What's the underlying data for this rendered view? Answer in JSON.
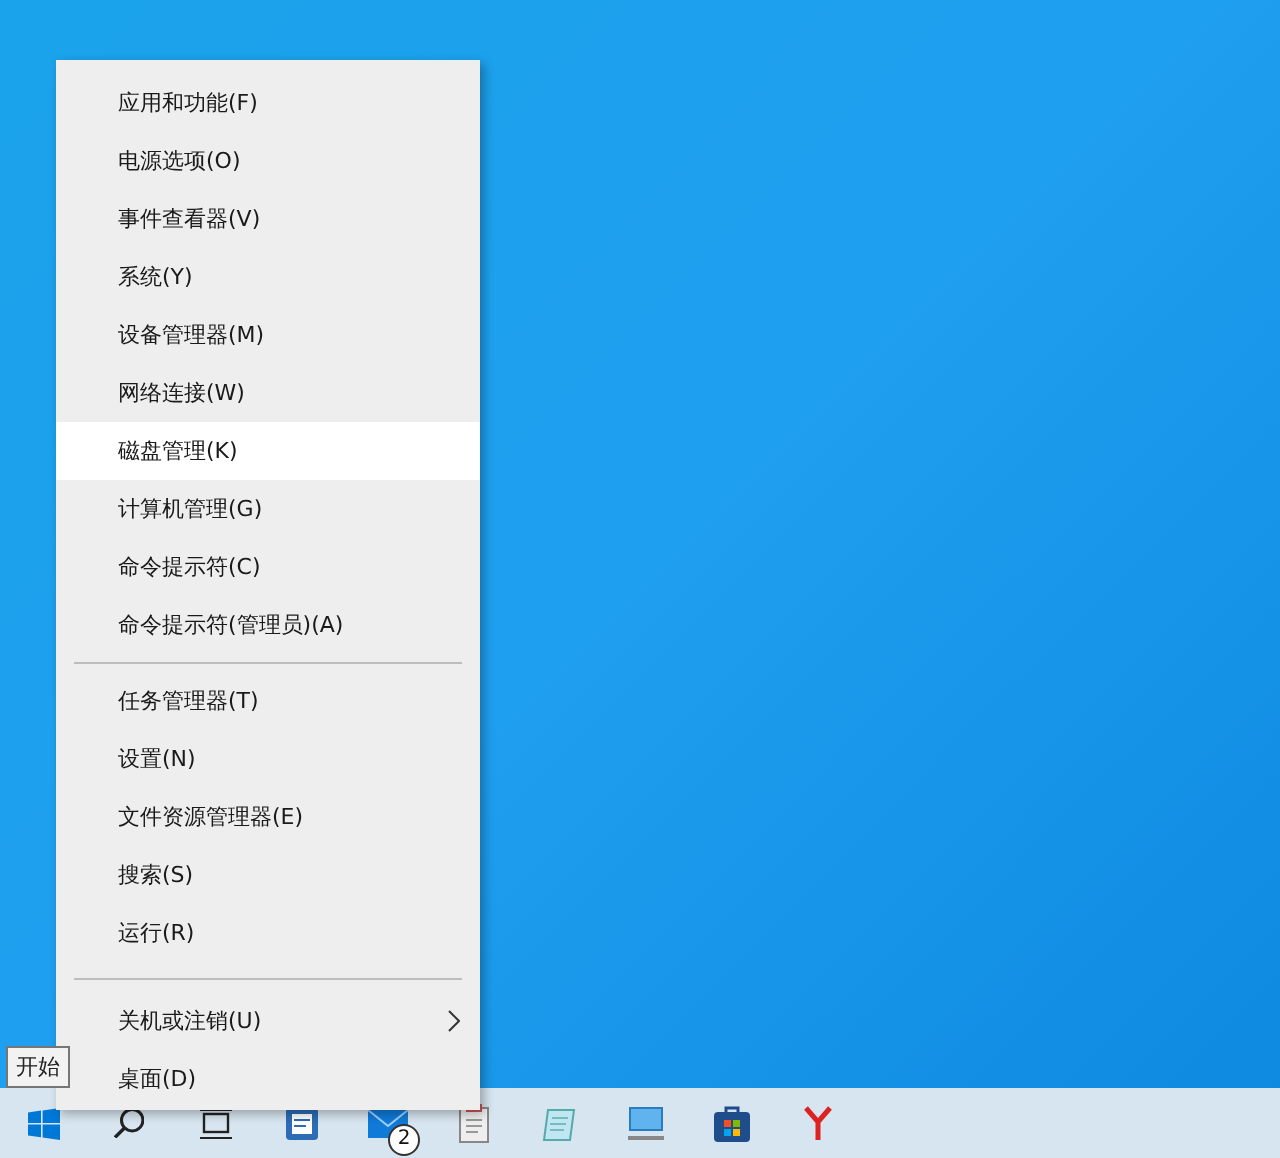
{
  "context_menu": {
    "groups": [
      [
        {
          "label": "应用和功能(F)",
          "selected": false,
          "has_submenu": false
        },
        {
          "label": "电源选项(O)",
          "selected": false,
          "has_submenu": false
        },
        {
          "label": "事件查看器(V)",
          "selected": false,
          "has_submenu": false
        },
        {
          "label": "系统(Y)",
          "selected": false,
          "has_submenu": false
        },
        {
          "label": "设备管理器(M)",
          "selected": false,
          "has_submenu": false
        },
        {
          "label": "网络连接(W)",
          "selected": false,
          "has_submenu": false
        },
        {
          "label": "磁盘管理(K)",
          "selected": true,
          "has_submenu": false
        },
        {
          "label": "计算机管理(G)",
          "selected": false,
          "has_submenu": false
        },
        {
          "label": "命令提示符(C)",
          "selected": false,
          "has_submenu": false
        },
        {
          "label": "命令提示符(管理员)(A)",
          "selected": false,
          "has_submenu": false
        }
      ],
      [
        {
          "label": "任务管理器(T)",
          "selected": false,
          "has_submenu": false
        },
        {
          "label": "设置(N)",
          "selected": false,
          "has_submenu": false
        },
        {
          "label": "文件资源管理器(E)",
          "selected": false,
          "has_submenu": false
        },
        {
          "label": "搜索(S)",
          "selected": false,
          "has_submenu": false
        },
        {
          "label": "运行(R)",
          "selected": false,
          "has_submenu": false
        }
      ],
      [
        {
          "label": "关机或注销(U)",
          "selected": false,
          "has_submenu": true
        },
        {
          "label": "桌面(D)",
          "selected": false,
          "has_submenu": false
        }
      ]
    ]
  },
  "tooltip": {
    "text": "开始"
  },
  "taskbar": {
    "icons": [
      {
        "kind": "start"
      },
      {
        "kind": "search"
      },
      {
        "kind": "taskview"
      },
      {
        "kind": "doc"
      },
      {
        "kind": "mail",
        "badge": "2"
      },
      {
        "kind": "clipboard"
      },
      {
        "kind": "notepad"
      },
      {
        "kind": "computer"
      },
      {
        "kind": "store"
      },
      {
        "kind": "red"
      }
    ]
  }
}
